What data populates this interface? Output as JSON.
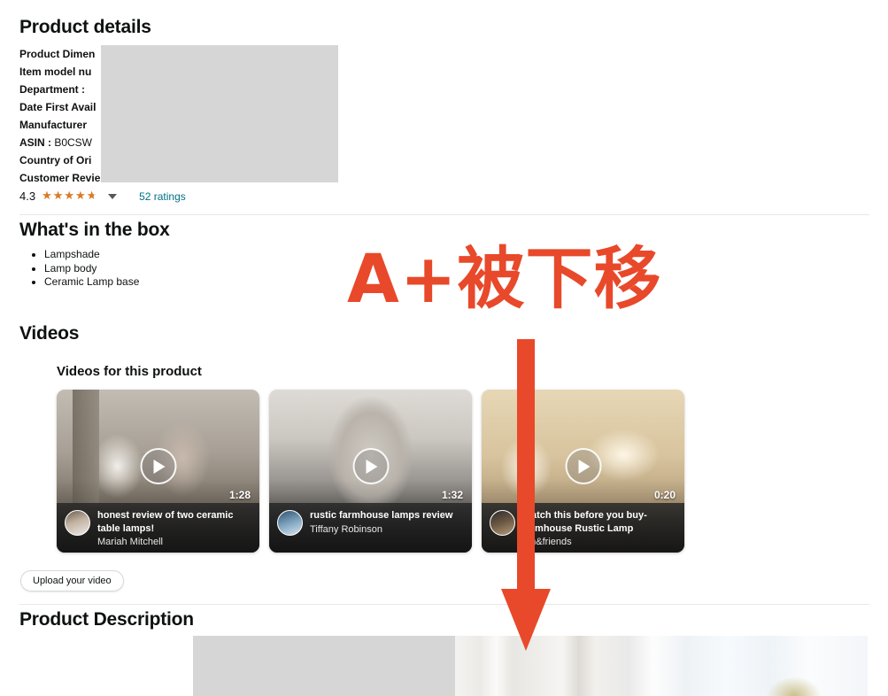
{
  "product_details": {
    "heading": "Product details",
    "rows": [
      {
        "label": "Product Dimen",
        "value": ""
      },
      {
        "label": "Item model nu",
        "value": ""
      },
      {
        "label": "Department  :",
        "value": ""
      },
      {
        "label": "Date First Avail",
        "value": ""
      },
      {
        "label": "Manufacturer",
        "value": ""
      },
      {
        "label": "ASIN  :",
        "value": " B0CSW"
      },
      {
        "label": "Country of Ori",
        "value": ""
      },
      {
        "label": "Customer Revie",
        "value": ""
      }
    ],
    "rating": {
      "value": "4.3",
      "stars_filled_percent": 90,
      "stars_glyphs": "★★★★★",
      "ratings_count_label": "52 ratings"
    }
  },
  "whats_in_box": {
    "heading": "What's in the box",
    "items": [
      "Lampshade",
      "Lamp body",
      "Ceramic Lamp base"
    ]
  },
  "videos": {
    "heading": "Videos",
    "subheading": "Videos for this product",
    "upload_button_label": "Upload your video",
    "cards": [
      {
        "title": "honest review of two ceramic table lamps!",
        "author": "Mariah Mitchell",
        "duration": "1:28"
      },
      {
        "title": "rustic farmhouse lamps review",
        "author": "Tiffany Robinson",
        "duration": "1:32"
      },
      {
        "title": "Watch this before you buy-farmhouse Rustic Lamp",
        "author": "am&friends",
        "duration": "0:20"
      }
    ]
  },
  "product_description": {
    "heading": "Product Description"
  },
  "annotation": {
    "text": "A+被下移",
    "color": "#E8492A"
  },
  "colors": {
    "link": "#007185",
    "star": "#DE7921",
    "text": "#0F1111",
    "redaction": "#d6d6d6",
    "divider": "#e7e7e7"
  }
}
